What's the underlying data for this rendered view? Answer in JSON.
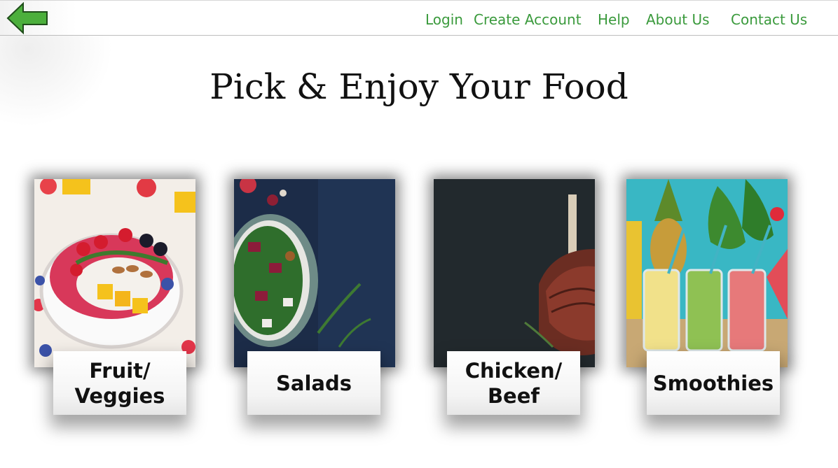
{
  "nav": {
    "back_icon": "arrow-left-icon",
    "back_color": "#4caf3c",
    "links": [
      "Login",
      "Create Account",
      "Help",
      "About Us",
      "Contact Us"
    ],
    "link_color": "#3a9a3c"
  },
  "page": {
    "title": "Pick & Enjoy Your Food"
  },
  "categories": [
    {
      "label_line1": "Fruit/",
      "label_line2": "Veggies"
    },
    {
      "label_line1": "Salads",
      "label_line2": ""
    },
    {
      "label_line1": "Chicken/",
      "label_line2": "Beef"
    },
    {
      "label_line1": "Smoothies",
      "label_line2": ""
    }
  ]
}
